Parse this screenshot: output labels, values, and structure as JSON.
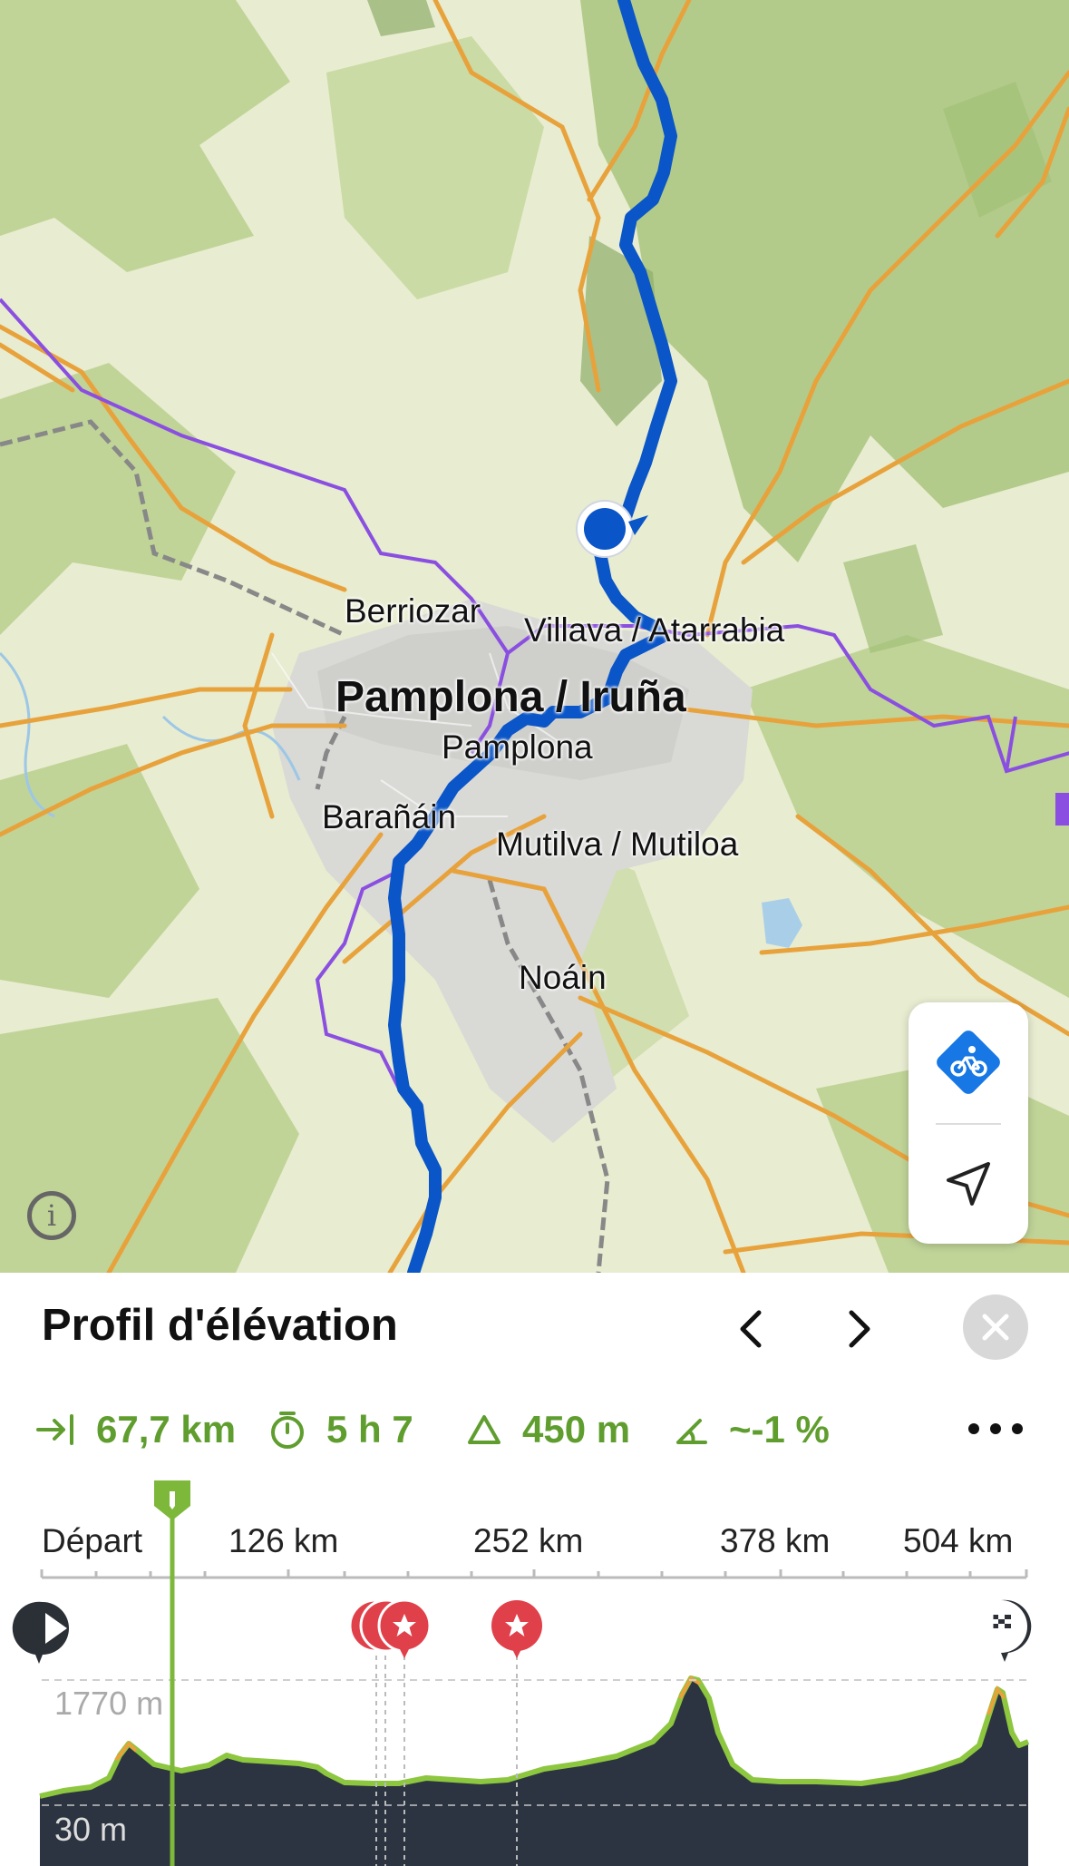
{
  "map": {
    "places": [
      {
        "name": "Berriozar"
      },
      {
        "name": "Villava / Atarrabia"
      },
      {
        "name": "Pamplona / Iruña"
      },
      {
        "name": "Pamplona"
      },
      {
        "name": "Barañáin"
      },
      {
        "name": "Mutilva / Mutiloa"
      },
      {
        "name": "Noáin"
      }
    ],
    "info_icon": "i",
    "controls": {
      "bike_icon": "bike-mode-icon",
      "locate_icon": "location-arrow-icon"
    },
    "colors": {
      "route": "#0a55c8",
      "road": "#e8a23c",
      "border": "#8a4fe0"
    }
  },
  "panel": {
    "title": "Profil d'élévation",
    "prev_icon": "chevron-left-icon",
    "next_icon": "chevron-right-icon",
    "close_icon": "close-icon",
    "stats": {
      "distance": "67,7 km",
      "duration": "5 h 7",
      "ascent": "450 m",
      "grade": "~-1 %"
    },
    "more_icon": "more-icon",
    "axis_labels": [
      "Départ",
      "126 km",
      "252 km",
      "378 km",
      "504 km"
    ],
    "elevation_max": "1770 m",
    "elevation_min": "30 m",
    "colors": {
      "accent": "#5f9e2e",
      "profile_fill": "#2b3440",
      "poi": "#e0404a"
    }
  }
}
